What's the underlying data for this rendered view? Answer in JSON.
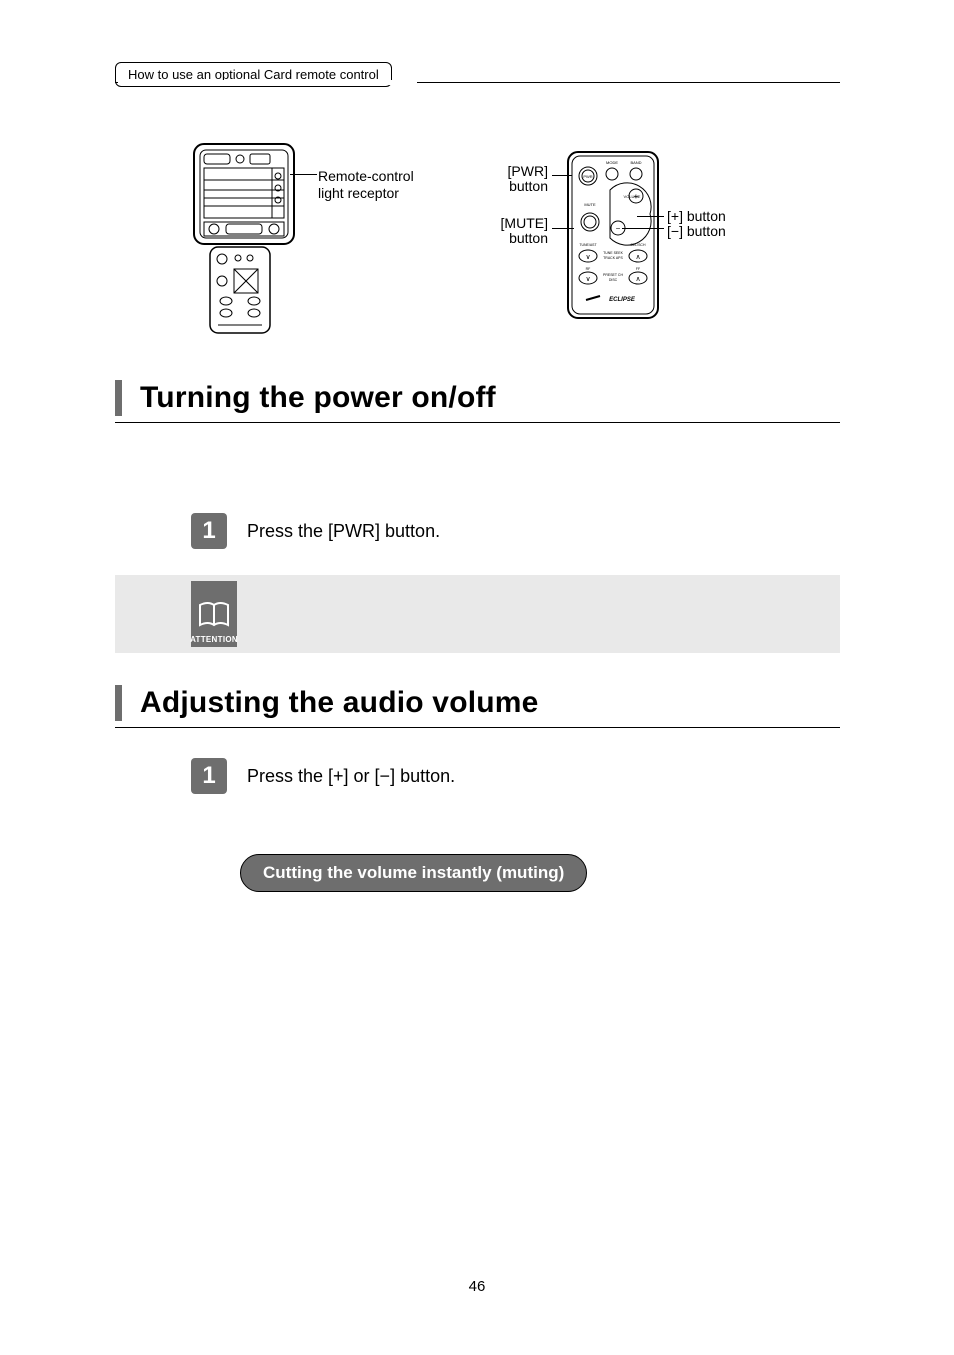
{
  "header": {
    "tab": "How to use an optional Card remote control"
  },
  "diagram": {
    "receptor_label_l1": "Remote-control",
    "receptor_label_l2": "light receptor",
    "pwr_l1": "[PWR]",
    "pwr_l2": "button",
    "mute_l1": "[MUTE]",
    "mute_l2": "button",
    "plus_l1": "[+] button",
    "plus_l2": "[−] button",
    "remote_labels": {
      "mode": "MODE",
      "band": "BAND",
      "mute": "MUTE",
      "volume": "VOLUME",
      "tune": "TUNE/AST",
      "seek": "SEL/SCH",
      "row1": "TUNE SEEK",
      "row1b": "TRACK APS",
      "row2": "RF",
      "row2b": "FF",
      "row3": "PRESET CH",
      "row3b": "DISC",
      "brand": "ECLIPSE",
      "pwr": "PWR"
    }
  },
  "section1": {
    "title": "Turning the power on/off",
    "step1_num": "1",
    "step1_text": "Press the [PWR] button."
  },
  "attention": {
    "label": "ATTENTION"
  },
  "section2": {
    "title": "Adjusting the audio volume",
    "step1_num": "1",
    "step1_text": "Press the [+] or [−] button."
  },
  "pill": {
    "text": "Cutting the volume instantly (muting)"
  },
  "page_number": "46"
}
